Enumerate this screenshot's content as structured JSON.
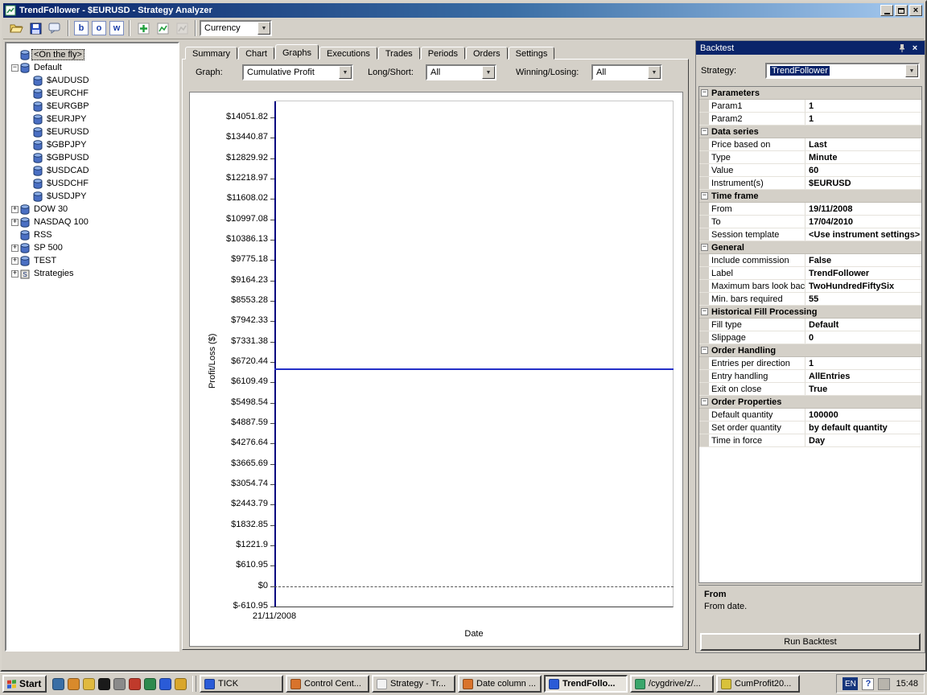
{
  "window": {
    "title": "TrendFollower - $EURUSD - Strategy Analyzer"
  },
  "toolbar": {
    "combo_value": "Currency",
    "letter_buttons": [
      "b",
      "o",
      "w"
    ]
  },
  "tree": {
    "items": [
      {
        "label": "<On the fly>",
        "depth": 0,
        "expander": "none",
        "icon": "database",
        "selected": true
      },
      {
        "label": "Default",
        "depth": 0,
        "expander": "minus",
        "icon": "database",
        "selected": false
      },
      {
        "label": "$AUDUSD",
        "depth": 1,
        "expander": "none",
        "icon": "database",
        "selected": false
      },
      {
        "label": "$EURCHF",
        "depth": 1,
        "expander": "none",
        "icon": "database",
        "selected": false
      },
      {
        "label": "$EURGBP",
        "depth": 1,
        "expander": "none",
        "icon": "database",
        "selected": false
      },
      {
        "label": "$EURJPY",
        "depth": 1,
        "expander": "none",
        "icon": "database",
        "selected": false
      },
      {
        "label": "$EURUSD",
        "depth": 1,
        "expander": "none",
        "icon": "database",
        "selected": false
      },
      {
        "label": "$GBPJPY",
        "depth": 1,
        "expander": "none",
        "icon": "database",
        "selected": false
      },
      {
        "label": "$GBPUSD",
        "depth": 1,
        "expander": "none",
        "icon": "database",
        "selected": false
      },
      {
        "label": "$USDCAD",
        "depth": 1,
        "expander": "none",
        "icon": "database",
        "selected": false
      },
      {
        "label": "$USDCHF",
        "depth": 1,
        "expander": "none",
        "icon": "database",
        "selected": false
      },
      {
        "label": "$USDJPY",
        "depth": 1,
        "expander": "none",
        "icon": "database",
        "selected": false
      },
      {
        "label": "DOW 30",
        "depth": 0,
        "expander": "plus",
        "icon": "database",
        "selected": false
      },
      {
        "label": "NASDAQ 100",
        "depth": 0,
        "expander": "plus",
        "icon": "database",
        "selected": false
      },
      {
        "label": "RSS",
        "depth": 0,
        "expander": "none",
        "icon": "database",
        "selected": false
      },
      {
        "label": "SP 500",
        "depth": 0,
        "expander": "plus",
        "icon": "database",
        "selected": false
      },
      {
        "label": "TEST",
        "depth": 0,
        "expander": "plus",
        "icon": "database",
        "selected": false
      },
      {
        "label": "Strategies",
        "depth": 0,
        "expander": "plus",
        "icon": "strategy",
        "selected": false
      }
    ]
  },
  "tabs": {
    "items": [
      "Summary",
      "Chart",
      "Graphs",
      "Executions",
      "Trades",
      "Periods",
      "Orders",
      "Settings"
    ],
    "active_index": 2
  },
  "graph_controls": {
    "graph_label": "Graph:",
    "graph_value": "Cumulative Profit",
    "longshort_label": "Long/Short:",
    "longshort_value": "All",
    "winning_label": "Winning/Losing:",
    "winning_value": "All"
  },
  "chart_data": {
    "type": "line",
    "title": "Cumulative Profit",
    "xlabel": "Date",
    "ylabel": "Profit/Loss ($)",
    "x_tick_labels": [
      "21/11/2008"
    ],
    "y_tick_labels": [
      "$14051.82",
      "$13440.87",
      "$12829.92",
      "$12218.97",
      "$11608.02",
      "$10997.08",
      "$10386.13",
      "$9775.18",
      "$9164.23",
      "$8553.28",
      "$7942.33",
      "$7331.38",
      "$6720.44",
      "$6109.49",
      "$5498.54",
      "$4887.59",
      "$4276.64",
      "$3665.69",
      "$3054.74",
      "$2443.79",
      "$1832.85",
      "$1221.9",
      "$610.95",
      "$0",
      "$-610.95"
    ],
    "y_tick_values": [
      14051.82,
      13440.87,
      12829.92,
      12218.97,
      11608.02,
      10997.08,
      10386.13,
      9775.18,
      9164.23,
      8553.28,
      7942.33,
      7331.38,
      6720.44,
      6109.49,
      5498.54,
      4887.59,
      4276.64,
      3665.69,
      3054.74,
      2443.79,
      1832.85,
      1221.9,
      610.95,
      0,
      -610.95
    ],
    "ylim": [
      -610.95,
      14051.82
    ],
    "grid": false,
    "series": [
      {
        "name": "Cumulative Profit",
        "shape": "flat-horizontal-line",
        "value": 6500,
        "color": "#2430c8"
      }
    ],
    "zero_line": 0,
    "axis_color": "#000080"
  },
  "backtest": {
    "title": "Backtest",
    "strategy_label": "Strategy:",
    "strategy_value": "TrendFollower",
    "groups": [
      {
        "name": "Parameters",
        "rows": [
          [
            "Param1",
            "1"
          ],
          [
            "Param2",
            "1"
          ]
        ]
      },
      {
        "name": "Data series",
        "rows": [
          [
            "Price based on",
            "Last"
          ],
          [
            "Type",
            "Minute"
          ],
          [
            "Value",
            "60"
          ],
          [
            "Instrument(s)",
            "$EURUSD"
          ]
        ]
      },
      {
        "name": "Time frame",
        "rows": [
          [
            "From",
            "19/11/2008"
          ],
          [
            "To",
            "17/04/2010"
          ],
          [
            "Session template",
            "<Use instrument settings>"
          ]
        ]
      },
      {
        "name": "General",
        "rows": [
          [
            "Include commission",
            "False"
          ],
          [
            "Label",
            "TrendFollower"
          ],
          [
            "Maximum bars look back",
            "TwoHundredFiftySix"
          ],
          [
            "Min. bars required",
            "55"
          ]
        ]
      },
      {
        "name": "Historical Fill Processing",
        "rows": [
          [
            "Fill type",
            "Default"
          ],
          [
            "Slippage",
            "0"
          ]
        ]
      },
      {
        "name": "Order Handling",
        "rows": [
          [
            "Entries per direction",
            "1"
          ],
          [
            "Entry handling",
            "AllEntries"
          ],
          [
            "Exit on close",
            "True"
          ]
        ]
      },
      {
        "name": "Order Properties",
        "rows": [
          [
            "Default quantity",
            "100000"
          ],
          [
            "Set order quantity",
            "by default quantity"
          ],
          [
            "Time in force",
            "Day"
          ]
        ]
      }
    ],
    "description_title": "From",
    "description_text": "From date.",
    "run_button": "Run Backtest"
  },
  "taskbar": {
    "start_label": "Start",
    "quick_launch_icons": [
      {
        "name": "show-desktop-icon",
        "color": "#3a6ea5"
      },
      {
        "name": "browser-globe-icon",
        "color": "#d98a2b"
      },
      {
        "name": "folder-icon",
        "color": "#e0b93f"
      },
      {
        "name": "console-icon",
        "color": "#1a1a1a"
      },
      {
        "name": "app-gray-icon",
        "color": "#8a8a8a"
      },
      {
        "name": "media-icon",
        "color": "#c03a2b"
      },
      {
        "name": "mail-icon",
        "color": "#2d8a4e"
      },
      {
        "name": "ie-icon",
        "color": "#2a5bd7"
      },
      {
        "name": "clock-icon",
        "color": "#d9a62b"
      }
    ],
    "window_buttons": [
      {
        "label": "TICK",
        "icon": "chart-icon",
        "color": "#2a5bd7",
        "active": false
      },
      {
        "label": "Control Cent...",
        "icon": "app-icon",
        "color": "#d9732b",
        "active": false
      },
      {
        "label": "Strategy - Tr...",
        "icon": "document-icon",
        "color": "#f2f2f2",
        "active": false
      },
      {
        "label": "Date column ...",
        "icon": "browser-icon",
        "color": "#d9732b",
        "active": false
      },
      {
        "label": "TrendFollo...",
        "icon": "chart-icon",
        "color": "#2a5bd7",
        "active": true
      },
      {
        "label": "/cygdrive/z/...",
        "icon": "terminal-icon",
        "color": "#3aa66b",
        "active": false
      },
      {
        "label": "CumProfit20...",
        "icon": "spreadsheet-icon",
        "color": "#d9c23a",
        "active": false
      }
    ],
    "tray": {
      "language": "EN",
      "icons": [
        "help-icon",
        "app-tray-icon"
      ],
      "time": "15:48"
    }
  }
}
